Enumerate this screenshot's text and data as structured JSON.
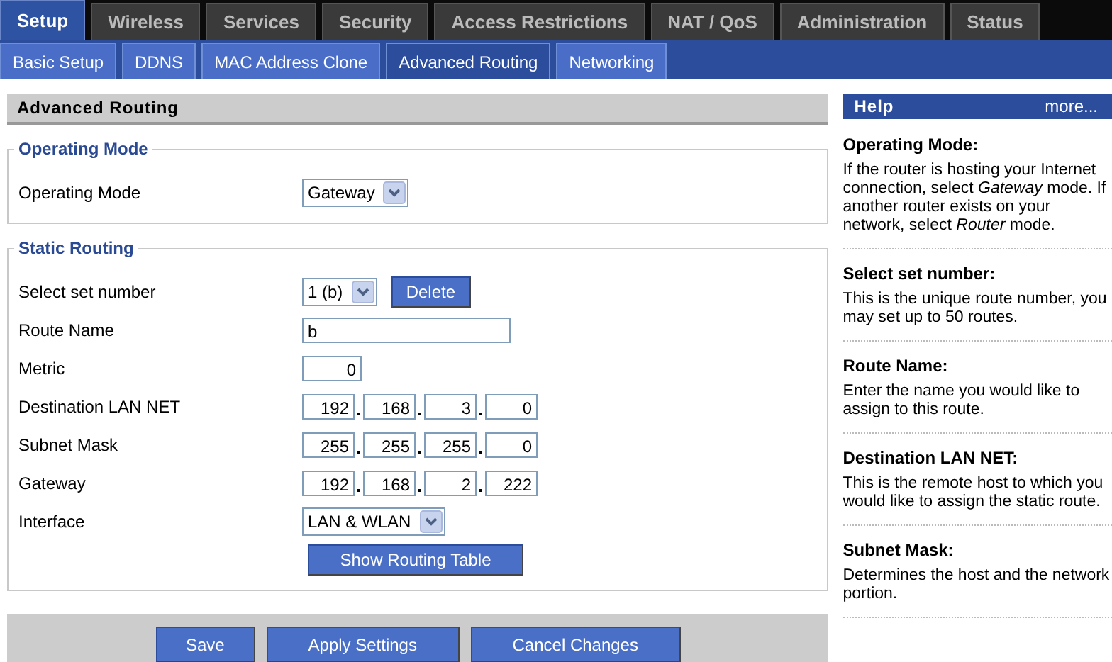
{
  "tabs": [
    {
      "label": "Setup",
      "selected": true
    },
    {
      "label": "Wireless",
      "selected": false
    },
    {
      "label": "Services",
      "selected": false
    },
    {
      "label": "Security",
      "selected": false
    },
    {
      "label": "Access Restrictions",
      "selected": false
    },
    {
      "label": "NAT / QoS",
      "selected": false
    },
    {
      "label": "Administration",
      "selected": false
    },
    {
      "label": "Status",
      "selected": false
    }
  ],
  "subtabs": [
    {
      "label": "Basic Setup",
      "selected": false
    },
    {
      "label": "DDNS",
      "selected": false
    },
    {
      "label": "MAC Address Clone",
      "selected": false
    },
    {
      "label": "Advanced Routing",
      "selected": true
    },
    {
      "label": "Networking",
      "selected": false
    }
  ],
  "page_title": "Advanced Routing",
  "sections": [
    {
      "title": "Operating Mode",
      "fields": [
        {
          "kind": "select",
          "label": "Operating Mode",
          "value": "Gateway"
        }
      ]
    },
    {
      "title": "Static Routing",
      "fields": [
        {
          "kind": "select",
          "label": "Select set number",
          "value": "1 (b)",
          "button": "Delete"
        },
        {
          "kind": "text",
          "label": "Route Name",
          "value": "b"
        },
        {
          "kind": "number",
          "label": "Metric",
          "value": "0"
        },
        {
          "kind": "ip",
          "label": "Destination LAN NET",
          "octets": [
            "192",
            "168",
            "3",
            "0"
          ]
        },
        {
          "kind": "ip",
          "label": "Subnet Mask",
          "octets": [
            "255",
            "255",
            "255",
            "0"
          ]
        },
        {
          "kind": "ip",
          "label": "Gateway",
          "octets": [
            "192",
            "168",
            "2",
            "222"
          ]
        },
        {
          "kind": "select",
          "label": "Interface",
          "value": "LAN & WLAN"
        },
        {
          "kind": "button",
          "button": "Show Routing Table"
        }
      ]
    }
  ],
  "footer_buttons": [
    "Save",
    "Apply Settings",
    "Cancel Changes"
  ],
  "help": {
    "title": "Help",
    "more": "more...",
    "items": [
      {
        "title": "Operating Mode:",
        "text": "If the router is hosting your Internet connection, select *Gateway* mode. If another router exists on your network, select *Router* mode."
      },
      {
        "title": "Select set number:",
        "text": "This is the unique route number, you may set up to 50 routes."
      },
      {
        "title": "Route Name:",
        "text": "Enter the name you would like to assign to this route."
      },
      {
        "title": "Destination LAN NET:",
        "text": "This is the remote host to which you would like to assign the static route."
      },
      {
        "title": "Subnet Mask:",
        "text": "Determines the host and the network portion."
      }
    ]
  }
}
